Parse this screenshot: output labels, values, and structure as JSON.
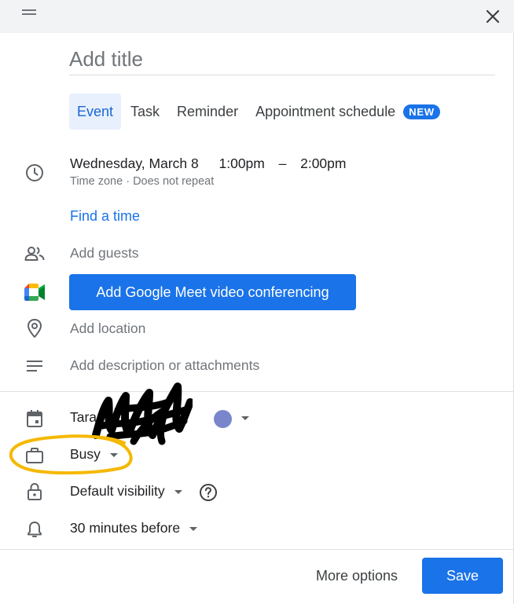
{
  "title": {
    "placeholder": "Add title"
  },
  "tabs": [
    {
      "label": "Event",
      "active": true
    },
    {
      "label": "Task",
      "active": false
    },
    {
      "label": "Reminder",
      "active": false
    },
    {
      "label": "Appointment schedule",
      "active": false,
      "badge": "NEW"
    }
  ],
  "datetime": {
    "date": "Wednesday, March 8",
    "start": "1:00pm",
    "separator": "–",
    "end": "2:00pm",
    "timezone": "Time zone",
    "dot": "·",
    "repeat": "Does not repeat"
  },
  "find_time": "Find a time",
  "guests": {
    "placeholder": "Add guests"
  },
  "meet": {
    "label": "Add Google Meet video conferencing"
  },
  "location": {
    "placeholder": "Add location"
  },
  "description": {
    "placeholder": "Add description or attachments"
  },
  "calendar": {
    "owner_partial": "Tara",
    "color": "#7986cb"
  },
  "availability": {
    "value": "Busy"
  },
  "visibility": {
    "value": "Default visibility"
  },
  "notification": {
    "value": "30 minutes before"
  },
  "footer": {
    "more_options": "More options",
    "save": "Save"
  },
  "colors": {
    "accent": "#1a73e8",
    "annotation_ring": "#f5b800",
    "scribble": "#000000"
  },
  "icons": {
    "clock": "clock-icon",
    "people": "people-icon",
    "meet": "google-meet-icon",
    "location": "location-pin-icon",
    "description": "notes-icon",
    "calendar": "calendar-icon",
    "briefcase": "briefcase-icon",
    "lock": "lock-icon",
    "bell": "bell-icon",
    "help": "help-icon",
    "close": "close-icon",
    "drag": "drag-handle-icon"
  }
}
